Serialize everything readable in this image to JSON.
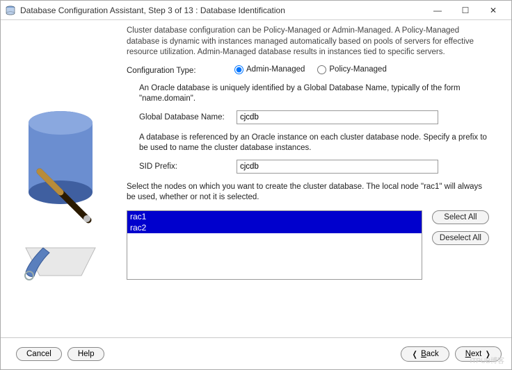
{
  "window": {
    "title": "Database Configuration Assistant, Step 3 of 13 : Database Identification"
  },
  "intro": "Cluster database configuration can be Policy-Managed or Admin-Managed. A Policy-Managed database is dynamic with instances managed automatically based on pools of servers for effective resource utilization. Admin-Managed database results in instances tied to specific servers.",
  "configType": {
    "label": "Configuration Type:",
    "admin": "Admin-Managed",
    "policy": "Policy-Managed",
    "selected": "admin"
  },
  "globalDb": {
    "note": "An Oracle database is uniquely identified by a Global Database Name, typically of the form \"name.domain\".",
    "label": "Global Database Name:",
    "value": "cjcdb"
  },
  "sid": {
    "note": "A database is referenced by an Oracle instance on each cluster database node. Specify a prefix to be used to name the cluster database instances.",
    "label": "SID Prefix:",
    "value": "cjcdb"
  },
  "nodes": {
    "note": "Select the nodes on which you want to create the cluster database. The local node \"rac1\" will always be used, whether or not it is selected.",
    "items": [
      "rac1",
      "rac2"
    ]
  },
  "buttons": {
    "selectAll": "Select All",
    "deselectAll": "Deselect All",
    "cancel": "Cancel",
    "help": "Help",
    "back": "Back",
    "next": "Next"
  },
  "watermark": "ITPUB博客"
}
